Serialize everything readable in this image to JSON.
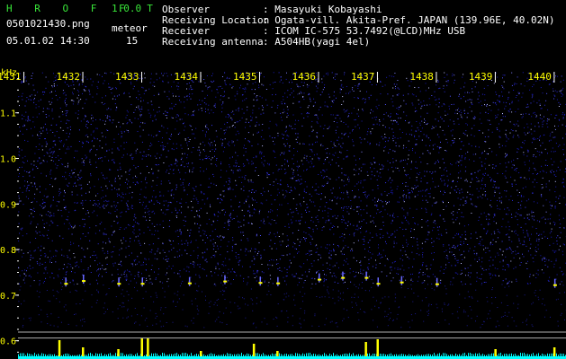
{
  "app": {
    "logo": "H R O F F T",
    "version": "1.0.0"
  },
  "info": {
    "filename": "0501021430.png",
    "datetime": "05.01.02 14:30",
    "meteor_label": "meteor",
    "meteor_count": "15",
    "fields": [
      {
        "label": "Observer",
        "value": ": Masayuki Kobayashi"
      },
      {
        "label": "Receiving Location",
        "value": ": Ogata-vill. Akita-Pref. JAPAN (139.96E, 40.02N)"
      },
      {
        "label": "Receiver",
        "value": ": ICOM IC-575 53.7492(@LCD)MHz USB"
      },
      {
        "label": "Receiving antenna",
        "value": ": A504HB(yagi 4el)"
      }
    ]
  },
  "colors": {
    "background": "#000000",
    "noise": "#2a2ad8",
    "tick_text": "#ffff00",
    "logo": "#39e639",
    "echo": "#ffff00",
    "baseline": "#00ffff"
  },
  "chart_data": {
    "type": "heatmap",
    "title": "",
    "ylabel": "kHz",
    "x": {
      "ticks": [
        "1431",
        "1432",
        "1433",
        "1434",
        "1435",
        "1436",
        "1437",
        "1438",
        "1439",
        "1440"
      ],
      "range": [
        1430.9,
        1440.2
      ]
    },
    "y": {
      "ticks": [
        "1.1",
        "1.0",
        "0.9",
        "0.8",
        "0.7",
        "0.6"
      ],
      "range": [
        0.56,
        1.19
      ]
    },
    "meteor_echoes": [
      {
        "time": 1431.7,
        "freq": 0.727
      },
      {
        "time": 1432.0,
        "freq": 0.733
      },
      {
        "time": 1432.6,
        "freq": 0.727
      },
      {
        "time": 1433.0,
        "freq": 0.727
      },
      {
        "time": 1433.8,
        "freq": 0.728
      },
      {
        "time": 1434.4,
        "freq": 0.732
      },
      {
        "time": 1435.0,
        "freq": 0.729
      },
      {
        "time": 1435.3,
        "freq": 0.728
      },
      {
        "time": 1436.0,
        "freq": 0.736
      },
      {
        "time": 1436.4,
        "freq": 0.74
      },
      {
        "time": 1436.8,
        "freq": 0.74
      },
      {
        "time": 1437.0,
        "freq": 0.727
      },
      {
        "time": 1437.4,
        "freq": 0.73
      },
      {
        "time": 1438.0,
        "freq": 0.726
      },
      {
        "time": 1440.0,
        "freq": 0.724
      }
    ],
    "signal_strength": [
      {
        "time": 1431.6,
        "level": 0.9
      },
      {
        "time": 1432.0,
        "level": 0.5
      },
      {
        "time": 1432.6,
        "level": 0.4
      },
      {
        "time": 1433.0,
        "level": 1.0
      },
      {
        "time": 1433.1,
        "level": 1.0
      },
      {
        "time": 1434.0,
        "level": 0.3
      },
      {
        "time": 1434.9,
        "level": 0.7
      },
      {
        "time": 1435.3,
        "level": 0.3
      },
      {
        "time": 1436.8,
        "level": 0.8
      },
      {
        "time": 1437.0,
        "level": 0.95
      },
      {
        "time": 1439.0,
        "level": 0.4
      },
      {
        "time": 1440.0,
        "level": 0.5
      }
    ]
  }
}
